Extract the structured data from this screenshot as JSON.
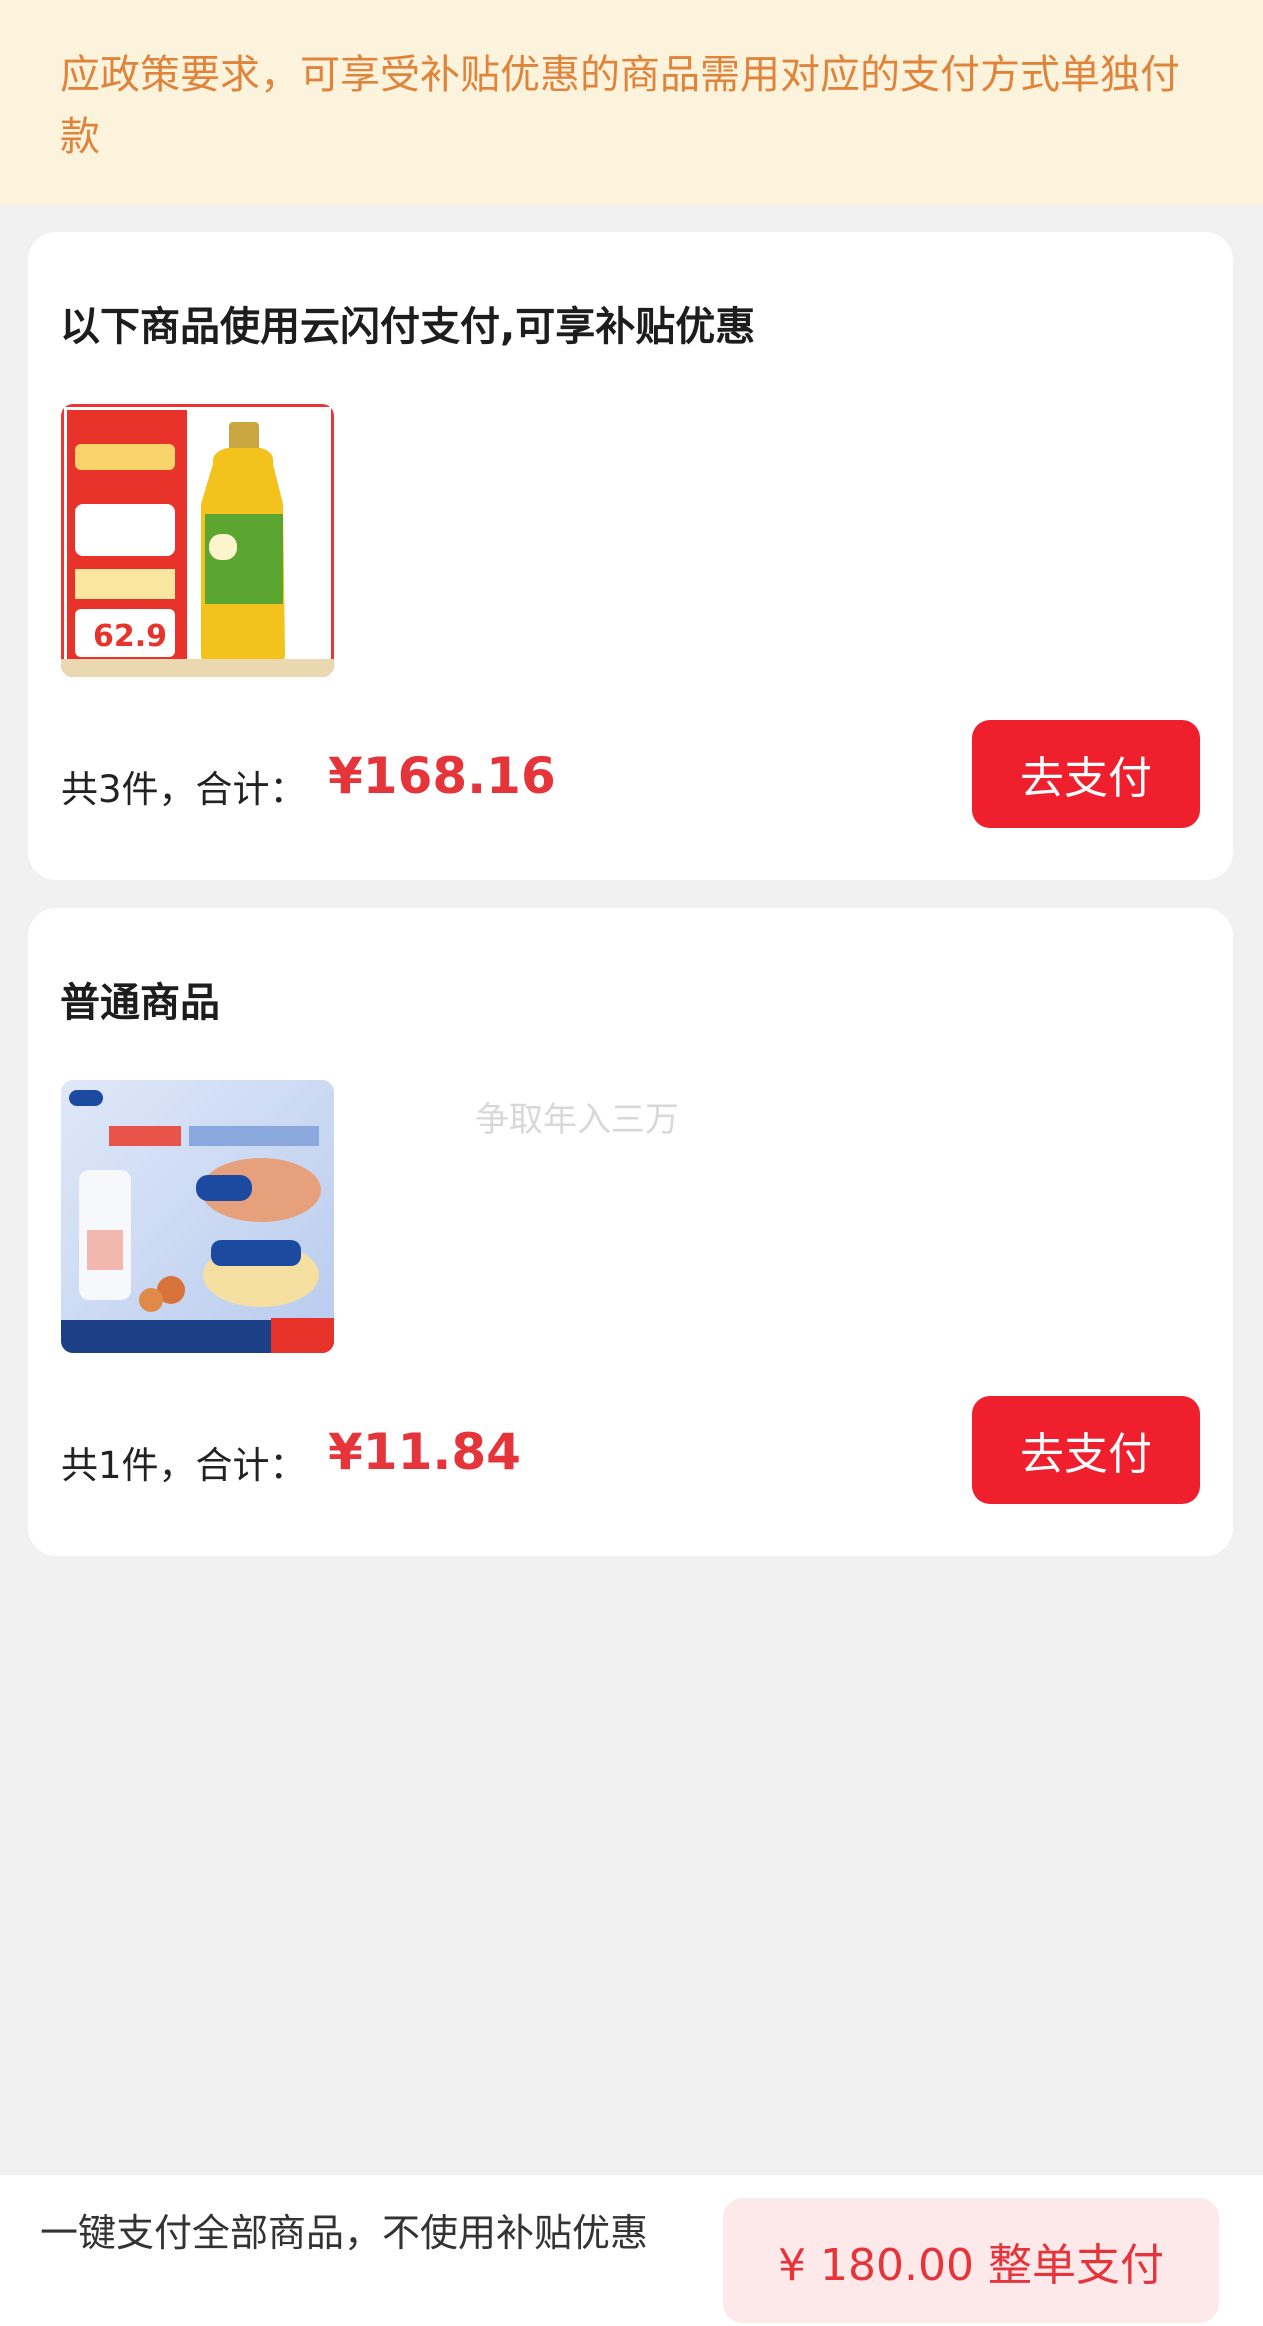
{
  "notice": {
    "text": "应政策要求，可享受补贴优惠的商品需用对应的支付方式单独付款"
  },
  "groups": [
    {
      "title": "以下商品使用云闪付支付,可享补贴优惠",
      "image_icon": "cooking-oil-product-image",
      "summary_prefix": "共3件，合计：",
      "price": "¥168.16",
      "pay_label": "去支付"
    },
    {
      "title": "普通商品",
      "image_icon": "vaseline-product-image",
      "summary_prefix": "共1件，合计：",
      "price": "¥11.84",
      "pay_label": "去支付"
    }
  ],
  "watermark": "争取年入三万",
  "bottom": {
    "description": "一键支付全部商品，不使用补贴优惠",
    "whole_pay_label": "¥ 180.00 整单支付"
  },
  "colors": {
    "accent_red": "#ef1f2d",
    "price_red": "#e6343b",
    "notice_bg": "#fcf3dc",
    "notice_text": "#e0843c"
  }
}
